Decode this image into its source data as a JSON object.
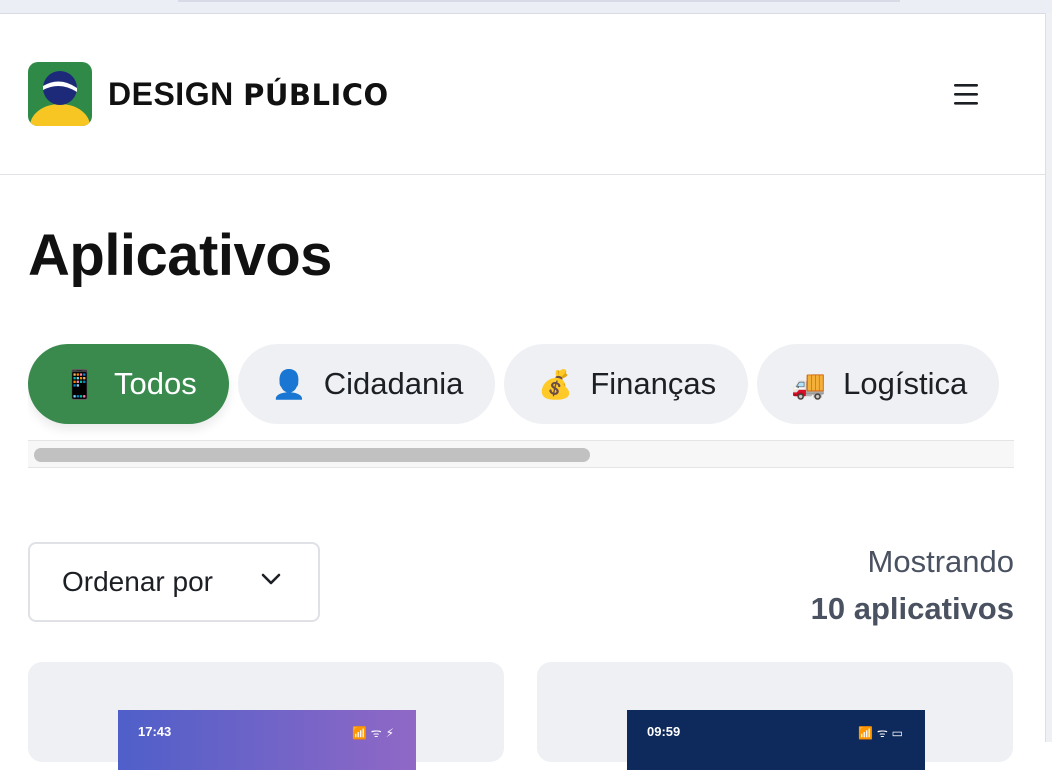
{
  "header": {
    "brand_bold": "DESIGN",
    "brand_light": "PÚBLICO",
    "menu_icon": "hamburger-menu-icon"
  },
  "page": {
    "title": "Aplicativos"
  },
  "categories": [
    {
      "emoji": "📱",
      "label": "Todos",
      "active": true
    },
    {
      "emoji": "👤",
      "label": "Cidadania",
      "active": false
    },
    {
      "emoji": "💰",
      "label": "Finanças",
      "active": false
    },
    {
      "emoji": "🚚",
      "label": "Logística",
      "active": false
    }
  ],
  "sort": {
    "label": "Ordenar por",
    "icon": "chevron-down-icon"
  },
  "results": {
    "prefix": "Mostrando",
    "count": "10 aplicativos"
  },
  "cards": [
    {
      "time": "17:43",
      "status": "📶 ᯤ ⚡"
    },
    {
      "time": "09:59",
      "status": "📶 ᯤ ▭"
    }
  ],
  "colors": {
    "accent": "#3a8a4e",
    "chip_bg": "#eef0f3",
    "text_muted": "#4a5160"
  }
}
